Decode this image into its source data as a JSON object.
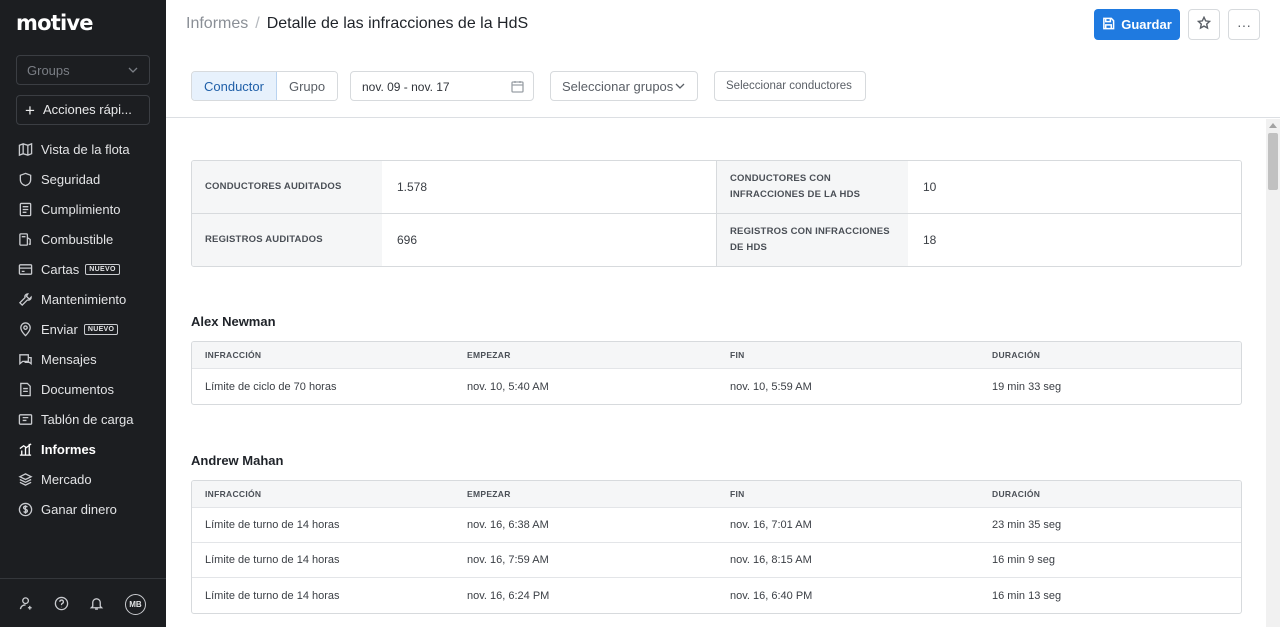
{
  "sidebar": {
    "logo": "motive",
    "groups_placeholder": "Groups",
    "quick_actions": "Acciones rápi...",
    "items": [
      {
        "label": "Vista de la flota",
        "icon": "map-icon"
      },
      {
        "label": "Seguridad",
        "icon": "shield-icon"
      },
      {
        "label": "Cumplimiento",
        "icon": "clipboard-icon"
      },
      {
        "label": "Combustible",
        "icon": "fuel-icon"
      },
      {
        "label": "Cartas",
        "icon": "card-icon",
        "badge": "NUEVO"
      },
      {
        "label": "Mantenimiento",
        "icon": "wrench-icon"
      },
      {
        "label": "Enviar",
        "icon": "location-pin-icon",
        "badge": "NUEVO"
      },
      {
        "label": "Mensajes",
        "icon": "message-icon"
      },
      {
        "label": "Documentos",
        "icon": "document-icon"
      },
      {
        "label": "Tablón de carga",
        "icon": "load-board-icon"
      },
      {
        "label": "Informes",
        "icon": "reports-icon",
        "active": true
      },
      {
        "label": "Mercado",
        "icon": "layers-icon"
      },
      {
        "label": "Ganar dinero",
        "icon": "dollar-icon"
      }
    ],
    "footer": {
      "avatar": "MB"
    }
  },
  "header": {
    "breadcrumb_parent": "Informes",
    "breadcrumb_sep": "/",
    "title": "Detalle de las infracciones de la HdS",
    "save_label": "Guardar",
    "more_label": "···"
  },
  "filters": {
    "toggle": [
      "Conductor",
      "Grupo"
    ],
    "date_range": "nov. 09 - nov. 17",
    "groups_placeholder": "Seleccionar grupos",
    "drivers_placeholder": "Seleccionar conductores"
  },
  "summary": [
    {
      "label": "CONDUCTORES AUDITADOS",
      "value": "1.578"
    },
    {
      "label": "CONDUCTORES CON INFRACCIONES DE LA HDS",
      "value": "10"
    },
    {
      "label": "REGISTROS AUDITADOS",
      "value": "696"
    },
    {
      "label": "REGISTROS CON INFRACCIONES DE HDS",
      "value": "18"
    }
  ],
  "columns": [
    "INFRACCIÓN",
    "EMPEZAR",
    "FIN",
    "DURACIÓN"
  ],
  "drivers": [
    {
      "name": "Alex Newman",
      "rows": [
        [
          "Límite de ciclo de 70 horas",
          "nov. 10, 5:40 AM",
          "nov. 10, 5:59 AM",
          "19 min 33 seg"
        ]
      ]
    },
    {
      "name": "Andrew Mahan",
      "rows": [
        [
          "Límite de turno de 14 horas",
          "nov. 16, 6:38 AM",
          "nov. 16, 7:01 AM",
          "23 min 35 seg"
        ],
        [
          "Límite de turno de 14 horas",
          "nov. 16, 7:59 AM",
          "nov. 16, 8:15 AM",
          "16 min 9 seg"
        ],
        [
          "Límite de turno de 14 horas",
          "nov. 16, 6:24 PM",
          "nov. 16, 6:40 PM",
          "16 min 13 seg"
        ]
      ]
    }
  ],
  "colors": {
    "accent": "#1f7ae0",
    "sidebar_bg": "#1c1e21"
  }
}
